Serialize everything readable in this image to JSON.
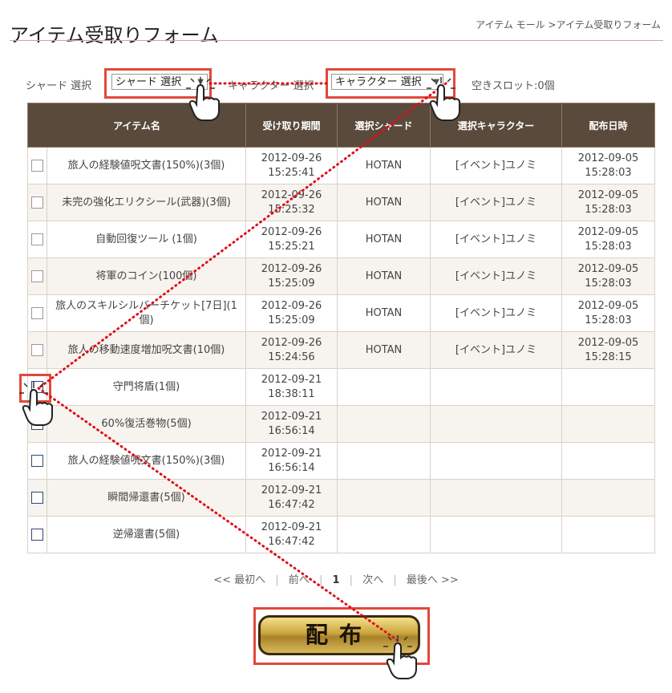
{
  "page": {
    "title": "アイテム受取りフォーム",
    "breadcrumb": "アイテム モール >アイテム受取りフォーム"
  },
  "filters": {
    "shard_label": "シャード 選択",
    "shard_value": "シャード 選択",
    "character_label": "キャラクター 選択",
    "character_value": "キャラクター 選択",
    "slots_label": "空きスロット:0個"
  },
  "table": {
    "headers": [
      "アイテム名",
      "受け取り期間",
      "選択シャード",
      "選択キャラクター",
      "配布日時"
    ],
    "rows": [
      {
        "name": "旅人の経験値呪文書(150%)(3個)",
        "period": [
          "2012-09-26",
          "15:25:41"
        ],
        "shard": "HOTAN",
        "character": "[イベント]ユノミ",
        "date": [
          "2012-09-05",
          "15:28:03"
        ]
      },
      {
        "name": "未完の強化エリクシール(武器)(3個)",
        "period": [
          "2012-09-26",
          "15:25:32"
        ],
        "shard": "HOTAN",
        "character": "[イベント]ユノミ",
        "date": [
          "2012-09-05",
          "15:28:03"
        ]
      },
      {
        "name": "自動回復ツール (1個)",
        "period": [
          "2012-09-26",
          "15:25:21"
        ],
        "shard": "HOTAN",
        "character": "[イベント]ユノミ",
        "date": [
          "2012-09-05",
          "15:28:03"
        ]
      },
      {
        "name": "将軍のコイン(100個)",
        "period": [
          "2012-09-26",
          "15:25:09"
        ],
        "shard": "HOTAN",
        "character": "[イベント]ユノミ",
        "date": [
          "2012-09-05",
          "15:28:03"
        ]
      },
      {
        "name": "旅人のスキルシルバーチケット[7日](1個)",
        "period": [
          "2012-09-26",
          "15:25:09"
        ],
        "shard": "HOTAN",
        "character": "[イベント]ユノミ",
        "date": [
          "2012-09-05",
          "15:28:03"
        ]
      },
      {
        "name": "旅人の移動速度増加呪文書(10個)",
        "period": [
          "2012-09-26",
          "15:24:56"
        ],
        "shard": "HOTAN",
        "character": "[イベント]ユノミ",
        "date": [
          "2012-09-05",
          "15:28:15"
        ]
      },
      {
        "name": "守門将盾(1個)",
        "period": [
          "2012-09-21",
          "18:38:11"
        ],
        "shard": "",
        "character": "",
        "date": [
          "",
          ""
        ]
      },
      {
        "name": "60%復活巻物(5個)",
        "period": [
          "2012-09-21",
          "16:56:14"
        ],
        "shard": "",
        "character": "",
        "date": [
          "",
          ""
        ]
      },
      {
        "name": "旅人の経験値呪文書(150%)(3個)",
        "period": [
          "2012-09-21",
          "16:56:14"
        ],
        "shard": "",
        "character": "",
        "date": [
          "",
          ""
        ]
      },
      {
        "name": "瞬間帰還書(5個)",
        "period": [
          "2012-09-21",
          "16:47:42"
        ],
        "shard": "",
        "character": "",
        "date": [
          "",
          ""
        ]
      },
      {
        "name": "逆帰還書(5個)",
        "period": [
          "2012-09-21",
          "16:47:42"
        ],
        "shard": "",
        "character": "",
        "date": [
          "",
          ""
        ]
      }
    ]
  },
  "pagination": {
    "first": "<< 最初へ",
    "prev": "前へ",
    "current": "1",
    "next": "次へ",
    "last": "最後へ >>"
  },
  "actions": {
    "distribute": "配布"
  },
  "colors": {
    "header_bg": "#5a4a3c",
    "highlight": "#e2483a",
    "dotted_line": "#e0101a"
  }
}
